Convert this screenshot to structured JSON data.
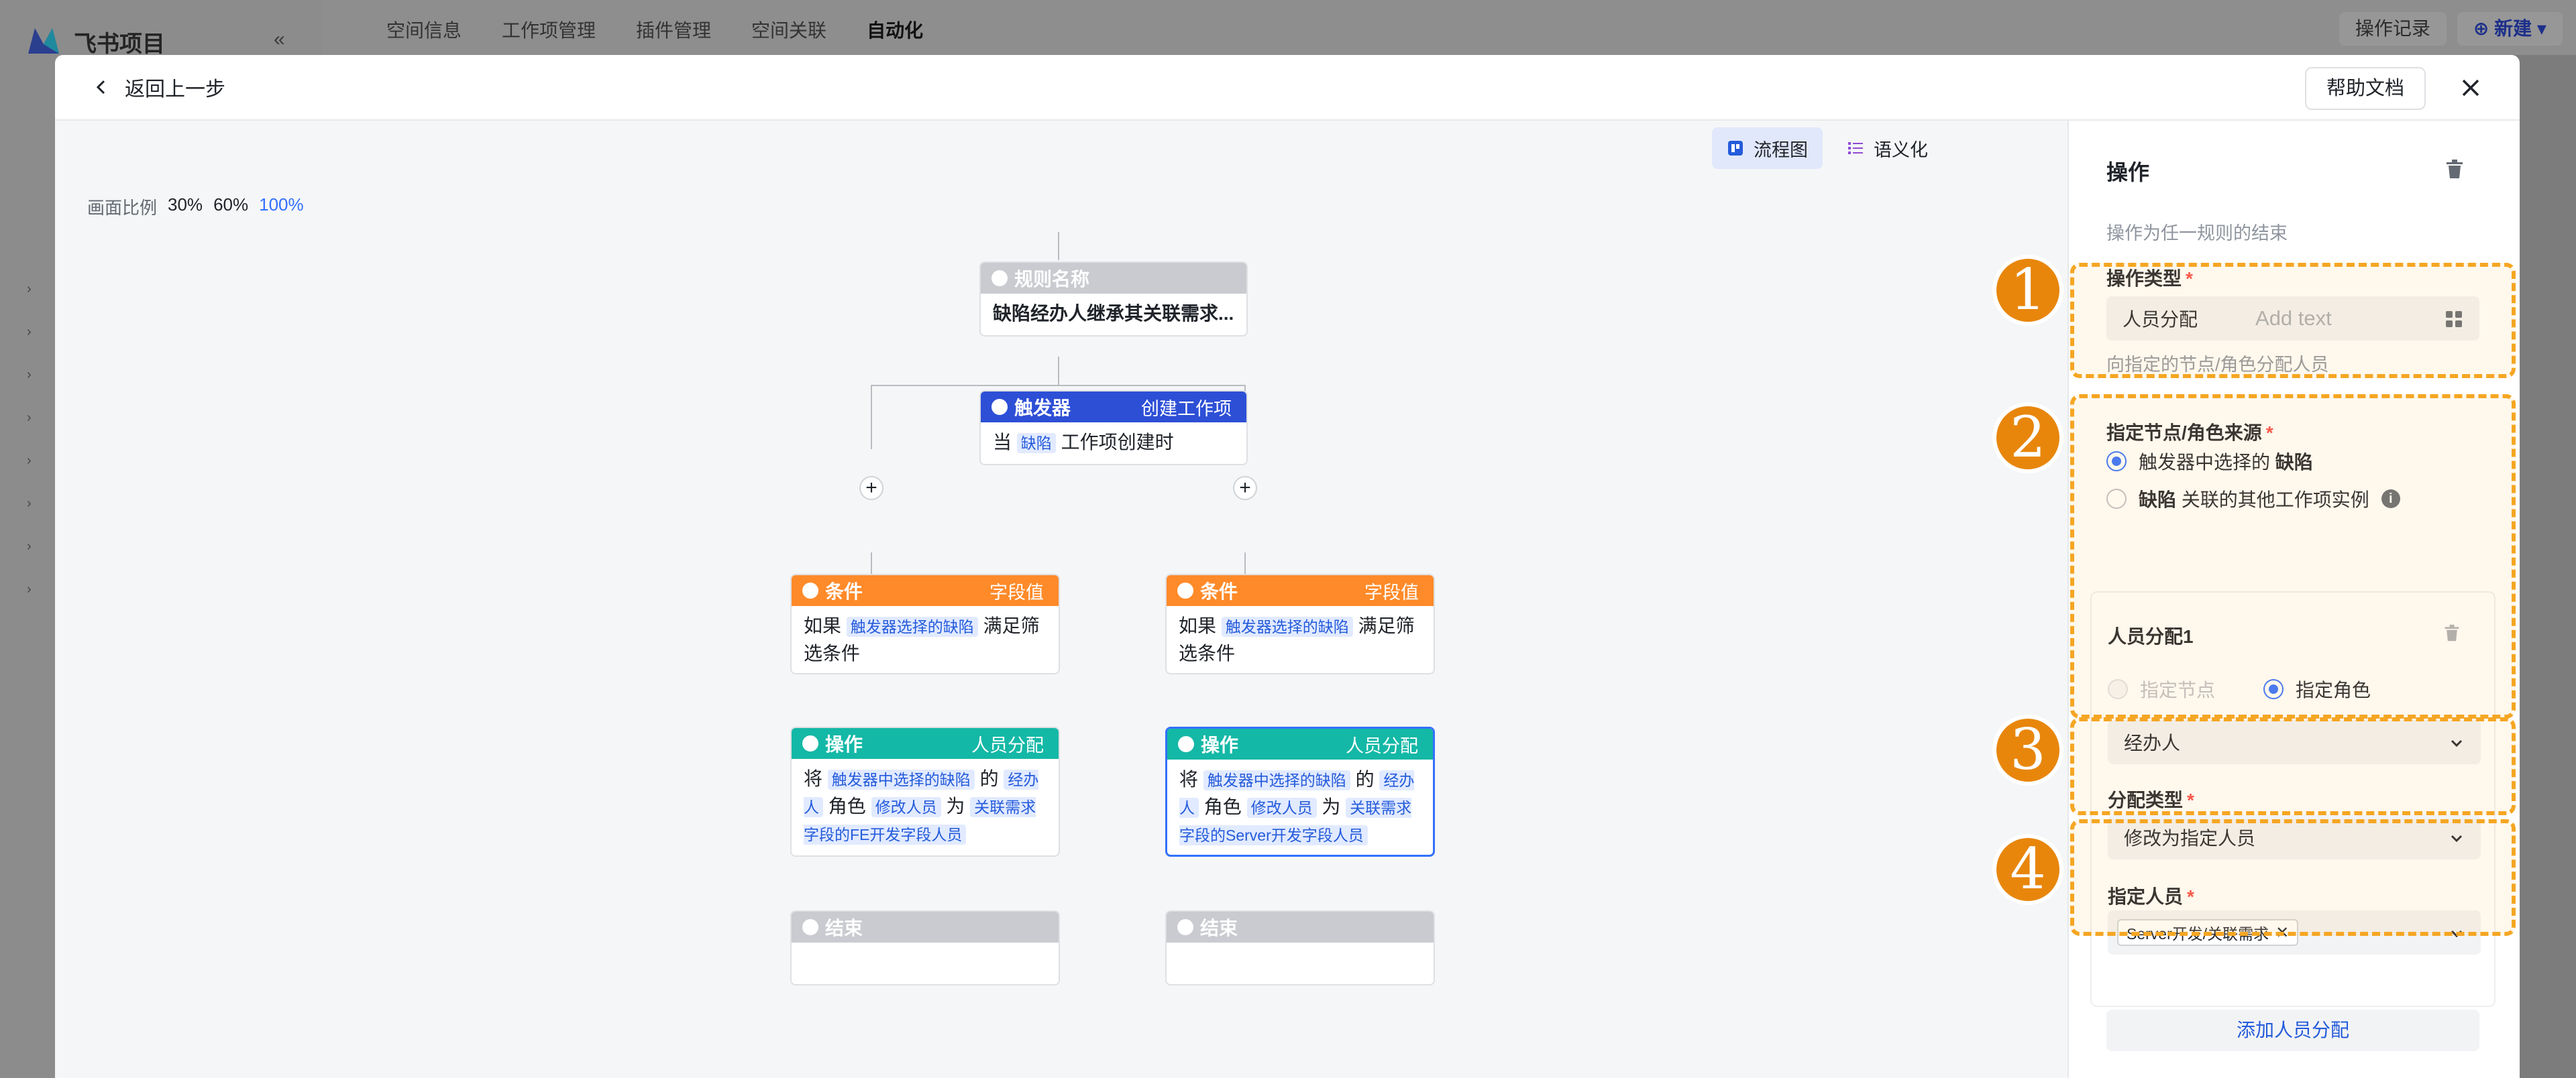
{
  "app": {
    "title": "飞书项目",
    "collapse": "«",
    "top_tabs": [
      "空间信息",
      "工作项管理",
      "插件管理",
      "空间关联",
      "自动化"
    ],
    "active_tab": "自动化",
    "history_btn": "操作记录",
    "new_btn": "新建"
  },
  "modal": {
    "back_label": "返回上一步",
    "help_label": "帮助文档"
  },
  "canvas": {
    "view_flow": "流程图",
    "view_semantic": "语义化",
    "ratio_label": "画面比例",
    "ratios": [
      "30%",
      "60%",
      "100%"
    ],
    "active_ratio": "100%"
  },
  "flow": {
    "rule": {
      "head": "规则名称",
      "body": "缺陷经办人继承其关联需求..."
    },
    "trigger": {
      "head": "触发器",
      "right": "创建工作项",
      "pre": "当",
      "tag": "缺陷",
      "post": "工作项创建时"
    },
    "left": {
      "cond": {
        "head": "条件",
        "right": "字段值",
        "pre": "如果",
        "tag": "触发器选择的缺陷",
        "post": "满足筛选条件"
      },
      "action": {
        "head": "操作",
        "right": "人员分配",
        "t1": "将",
        "tag1": "触发器中选择的缺陷",
        "t2": "的",
        "tag2": "经办人",
        "t3": "角色",
        "tag3": "修改人员",
        "t4": "为",
        "tag4": "关联需求字段的FE开发字段人员"
      },
      "end": {
        "head": "结束"
      }
    },
    "right": {
      "cond": {
        "head": "条件",
        "right": "字段值",
        "pre": "如果",
        "tag": "触发器选择的缺陷",
        "post": "满足筛选条件"
      },
      "action": {
        "head": "操作",
        "right": "人员分配",
        "t1": "将",
        "tag1": "触发器中选择的缺陷",
        "t2": "的",
        "tag2": "经办人",
        "t3": "角色",
        "tag3": "修改人员",
        "t4": "为",
        "tag4": "关联需求字段的Server开发字段人员"
      },
      "end": {
        "head": "结束"
      }
    }
  },
  "panel": {
    "title": "操作",
    "subtitle": "操作为任一规则的结束",
    "op_type": {
      "label": "操作类型",
      "value": "人员分配",
      "placeholder": "Add text",
      "hint": "向指定的节点/角色分配人员"
    },
    "source": {
      "label": "指定节点/角色来源",
      "opt1_pre": "触发器中选择的",
      "opt1_bold": "缺陷",
      "opt2_bold": "缺陷",
      "opt2_post": "关联的其他工作项实例"
    },
    "assign": {
      "title": "人员分配1",
      "opt_node": "指定节点",
      "opt_role": "指定角色",
      "role_value": "经办人",
      "type_label": "分配类型",
      "type_value": "修改为指定人员",
      "people_label": "指定人员",
      "people_chip": "Server开发/关联需求"
    },
    "add_label": "添加人员分配"
  },
  "annotations": [
    "1",
    "2",
    "3",
    "4"
  ],
  "colors": {
    "accent": "#3370ff",
    "annotation": "#f5a623",
    "trigger": "#2d4fd6",
    "condition": "#ff8a29",
    "action": "#14b8a6"
  }
}
